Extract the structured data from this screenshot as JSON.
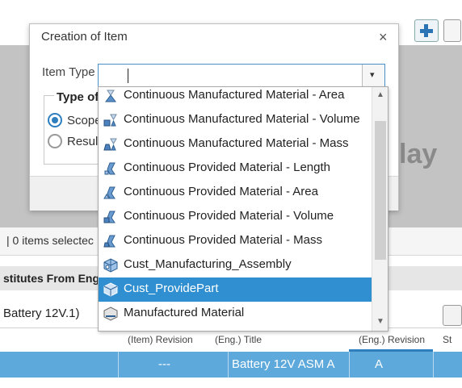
{
  "background": {
    "display_text": "lay",
    "selection_info": "| 0 items selectec",
    "panel_title": "stitutes From Engi",
    "battery_item": "Battery 12V.1)",
    "columns": [
      "(Item) Revision",
      "(Eng.) Title",
      "(Eng.) Revision",
      "St"
    ],
    "row": {
      "item_revision": "---",
      "title": "Battery 12V ASM A",
      "eng_revision": "A"
    }
  },
  "dialog": {
    "title": "Creation of Item",
    "close_icon": "×",
    "item_type_label": "Item Type",
    "item_type_value": "",
    "dropdown_arrow": "▾",
    "group_title": "Type of",
    "radio_scope": "Scope",
    "radio_result": "Resul"
  },
  "dropdown": {
    "scroll_up": "▲",
    "scroll_down": "▼",
    "selected_index": 8,
    "options": [
      {
        "label": "Continuous Manufactured Material - Area",
        "icon": "manufactured-material-area-icon"
      },
      {
        "label": "Continuous Manufactured Material - Volume",
        "icon": "manufactured-material-volume-icon"
      },
      {
        "label": "Continuous Manufactured Material - Mass",
        "icon": "manufactured-material-mass-icon"
      },
      {
        "label": "Continuous Provided Material - Length",
        "icon": "provided-material-length-icon"
      },
      {
        "label": "Continuous Provided Material - Area",
        "icon": "provided-material-area-icon"
      },
      {
        "label": "Continuous Provided Material - Volume",
        "icon": "provided-material-volume-icon"
      },
      {
        "label": "Continuous Provided Material - Mass",
        "icon": "provided-material-mass-icon"
      },
      {
        "label": "Cust_Manufacturing_Assembly",
        "icon": "manufacturing-assembly-icon"
      },
      {
        "label": "Cust_ProvidePart",
        "icon": "provide-part-icon"
      },
      {
        "label": "Manufactured Material",
        "icon": "manufactured-material-icon"
      }
    ]
  },
  "colors": {
    "accent": "#2f8fd0",
    "row_highlight": "#5ea9dc"
  }
}
